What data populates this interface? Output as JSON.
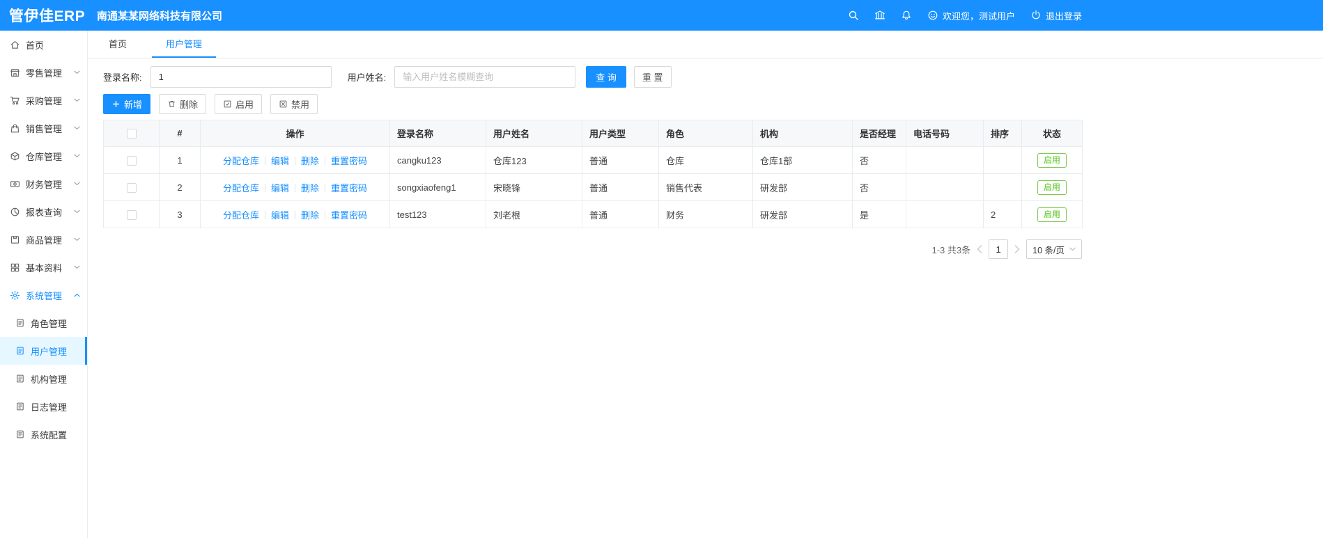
{
  "topbar": {
    "logo": "管伊佳ERP",
    "company": "南通某某网络科技有限公司",
    "welcome": "欢迎您，测试用户",
    "logout": "退出登录"
  },
  "sidebar": {
    "items": [
      {
        "label": "首页"
      },
      {
        "label": "零售管理"
      },
      {
        "label": "采购管理"
      },
      {
        "label": "销售管理"
      },
      {
        "label": "仓库管理"
      },
      {
        "label": "财务管理"
      },
      {
        "label": "报表查询"
      },
      {
        "label": "商品管理"
      },
      {
        "label": "基本资料"
      },
      {
        "label": "系统管理"
      }
    ],
    "subitems": [
      {
        "label": "角色管理"
      },
      {
        "label": "用户管理"
      },
      {
        "label": "机构管理"
      },
      {
        "label": "日志管理"
      },
      {
        "label": "系统配置"
      }
    ]
  },
  "tabs": [
    {
      "label": "首页"
    },
    {
      "label": "用户管理"
    }
  ],
  "filter": {
    "login_label": "登录名称:",
    "login_value": "1",
    "name_label": "用户姓名:",
    "name_placeholder": "输入用户姓名模糊查询",
    "search": "查 询",
    "reset": "重 置"
  },
  "toolbar": {
    "add": "新增",
    "delete": "删除",
    "enable": "启用",
    "disable": "禁用"
  },
  "table": {
    "headers": {
      "index": "#",
      "actions": "操作",
      "login": "登录名称",
      "name": "用户姓名",
      "type": "用户类型",
      "role": "角色",
      "org": "机构",
      "manager": "是否经理",
      "phone": "电话号码",
      "sort": "排序",
      "status": "状态"
    },
    "action_links": [
      "分配仓库",
      "编辑",
      "删除",
      "重置密码"
    ],
    "rows": [
      {
        "index": "1",
        "login": "cangku123",
        "name": "仓库123",
        "type": "普通",
        "role": "仓库",
        "org": "仓库1部",
        "manager": "否",
        "phone": "",
        "sort": "",
        "status": "启用"
      },
      {
        "index": "2",
        "login": "songxiaofeng1",
        "name": "宋晓锋",
        "type": "普通",
        "role": "销售代表",
        "org": "研发部",
        "manager": "否",
        "phone": "",
        "sort": "",
        "status": "启用"
      },
      {
        "index": "3",
        "login": "test123",
        "name": "刘老根",
        "type": "普通",
        "role": "财务",
        "org": "研发部",
        "manager": "是",
        "phone": "",
        "sort": "2",
        "status": "启用"
      }
    ]
  },
  "pagination": {
    "total": "1-3 共3条",
    "current_page": "1",
    "page_size": "10 条/页"
  },
  "icons": {
    "topbar": [
      "search-icon",
      "building-icon",
      "bell-icon",
      "smiley-icon",
      "logout-icon"
    ],
    "toolbar": [
      "plus-icon",
      "trash-icon",
      "check-square-icon",
      "x-square-icon"
    ],
    "sidebar": [
      "home-icon",
      "store-icon",
      "cart-icon",
      "bag-icon",
      "box-icon",
      "money-icon",
      "pie-chart-icon",
      "goods-icon",
      "grid-icon",
      "gear-icon",
      "doc-icon"
    ]
  },
  "colors": {
    "primary": "#1890ff",
    "success": "#52c41a",
    "active_bg": "#e6f7ff"
  }
}
